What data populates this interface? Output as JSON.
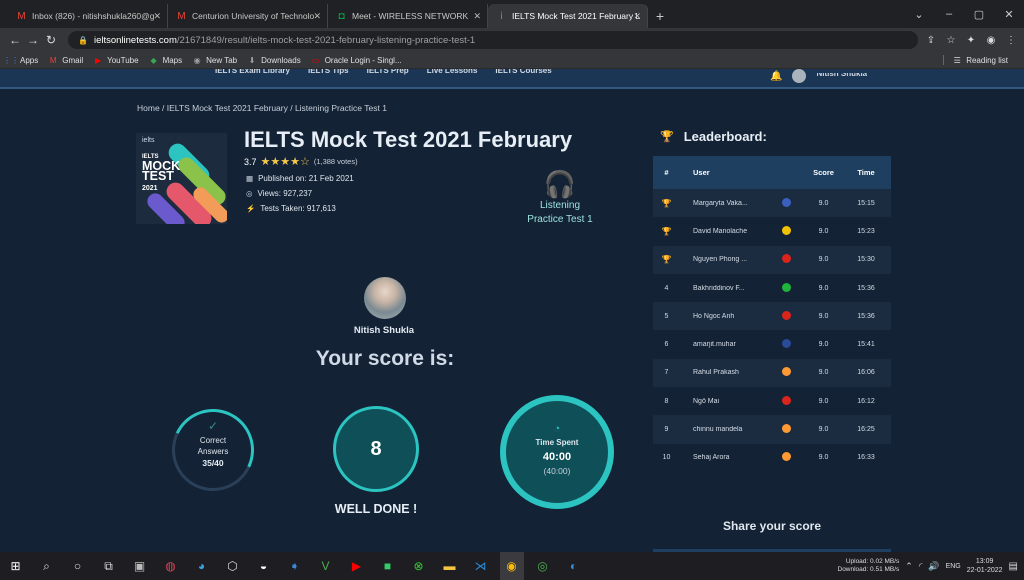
{
  "browser": {
    "tabs": [
      {
        "title": "Inbox (826) - nitishshukla260@g",
        "icon": "gmail-icon",
        "color": "#ea4335",
        "glyph": "M",
        "active": false
      },
      {
        "title": "Centurion University of Technolo",
        "icon": "gmail-icon",
        "color": "#ea4335",
        "glyph": "M",
        "active": false
      },
      {
        "title": "Meet - WIRELESS NETWORK",
        "icon": "meet-icon",
        "color": "#00ac47",
        "glyph": "◘",
        "active": false
      },
      {
        "title": "IELTS Mock Test 2021 February L",
        "icon": "ielts-icon",
        "color": "#4a90d9",
        "glyph": "ⅰ",
        "active": true
      }
    ],
    "new_tab": "+",
    "url_host": "ieltsonlinetests.com",
    "url_path": "/21671849/result/ielts-mock-test-2021-february-listening-practice-test-1",
    "bookmarks": [
      {
        "label": "Apps",
        "icon": "apps-icon",
        "color": "#4285f4",
        "glyph": "⋮⋮"
      },
      {
        "label": "Gmail",
        "icon": "gmail-icon",
        "color": "#ea4335",
        "glyph": "M"
      },
      {
        "label": "YouTube",
        "icon": "youtube-icon",
        "color": "#ff0000",
        "glyph": "▶"
      },
      {
        "label": "Maps",
        "icon": "maps-icon",
        "color": "#34a853",
        "glyph": "◆"
      },
      {
        "label": "New Tab",
        "icon": "chrome-icon",
        "color": "#9aa0a6",
        "glyph": "◉"
      },
      {
        "label": "Downloads",
        "icon": "download-icon",
        "color": "#9aa0a6",
        "glyph": "⬇"
      },
      {
        "label": "Oracle Login - Singl...",
        "icon": "oracle-icon",
        "color": "#f80000",
        "glyph": "▭"
      }
    ],
    "reading_list": "Reading list"
  },
  "site": {
    "menu": [
      "IELTS Exam Library",
      "IELTS Tips",
      "IELTS Prep",
      "Live Lessons",
      "IELTS Courses"
    ],
    "user_name": "Nitish Shukla",
    "breadcrumb": "Home  /  IELTS Mock Test 2021 February  /  Listening Practice Test 1"
  },
  "test": {
    "cover_logo": "ielts",
    "cover_lines": "IELTS\nMOCK\nTEST\n2021",
    "cover_text_a": "MOCK",
    "cover_text_b": "TEST",
    "cover_year": "2021",
    "title": "IELTS Mock Test 2021 February",
    "rating": "3.7",
    "stars": "★★★★☆",
    "votes": "(1,388 votes)",
    "published": "Published on: 21 Feb 2021",
    "views": "Views: 927,237",
    "tests_taken": "Tests Taken: 917,613",
    "section": "Listening Practice Test 1"
  },
  "result": {
    "user": "Nitish Shukla",
    "heading": "Your score is:",
    "correct_label": "Correct Answers",
    "correct_value": "35/40",
    "correct_fraction": 0.875,
    "score": "8",
    "well_done": "WELL DONE !",
    "time_label": "Time Spent",
    "time_value": "40:00",
    "time_limit": "(40:00)"
  },
  "leaderboard": {
    "title": "Leaderboard:",
    "headers": [
      "#",
      "User",
      "Score",
      "Time"
    ],
    "rows": [
      {
        "rank": "",
        "rank_icon": "gold-trophy-icon",
        "rank_color": "#c9a24a",
        "user": "Margaryta Vaka...",
        "flag_color": "#3b5fbf",
        "score": "9.0",
        "time": "15:15"
      },
      {
        "rank": "",
        "rank_icon": "red-trophy-icon",
        "rank_color": "#e05a6a",
        "user": "David Manolache",
        "flag_color": "#f2c200",
        "score": "9.0",
        "time": "15:23"
      },
      {
        "rank": "",
        "rank_icon": "teal-trophy-icon",
        "rank_color": "#2cc4c1",
        "user": "Nguyen Phong ...",
        "flag_color": "#da251d",
        "score": "9.0",
        "time": "15:30"
      },
      {
        "rank": "4",
        "user": "Bakhriddinov F...",
        "flag_color": "#1eb53a",
        "score": "9.0",
        "time": "15:36"
      },
      {
        "rank": "5",
        "user": "Ho Ngoc Anh",
        "flag_color": "#da251d",
        "score": "9.0",
        "time": "15:36"
      },
      {
        "rank": "6",
        "user": "amarjit.muhar",
        "flag_color": "#2a4a9a",
        "score": "9.0",
        "time": "15:41"
      },
      {
        "rank": "7",
        "user": "Rahul Prakash",
        "flag_color": "#ff9933",
        "score": "9.0",
        "time": "16:06"
      },
      {
        "rank": "8",
        "user": "Ngô Mai",
        "flag_color": "#da251d",
        "score": "9.0",
        "time": "16:12"
      },
      {
        "rank": "9",
        "user": "chinnu mandela",
        "flag_color": "#ff9933",
        "score": "9.0",
        "time": "16:25"
      },
      {
        "rank": "10",
        "user": "Sehaj Arora",
        "flag_color": "#ff9933",
        "score": "9.0",
        "time": "16:33"
      }
    ],
    "share": "Share your score"
  },
  "taskbar": {
    "upload_label": "Upload:",
    "upload_value": "0.02 MB/s",
    "download_label": "Download:",
    "download_value": "0.51 MB/s",
    "lang": "ENG",
    "time": "13:09",
    "date": "22-01-2022"
  }
}
